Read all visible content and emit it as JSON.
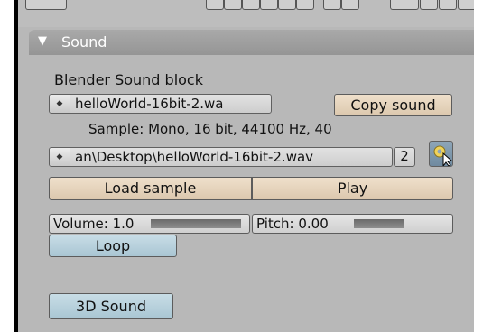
{
  "panel": {
    "title": "Sound",
    "collapse_icon": "triangle-down-icon"
  },
  "sound_block": {
    "label": "Blender Sound block",
    "name": "helloWorld-16bit-2.wa",
    "copy_button": "Copy sound"
  },
  "sample": {
    "info": "Sample: Mono, 16 bit, 44100 Hz, 40",
    "path": "an\\Desktop\\helloWorld-16bit-2.wav",
    "users": "2",
    "pack_icon": "gear-icon",
    "load_button": "Load sample",
    "play_button": "Play"
  },
  "controls": {
    "volume_label": "Volume: 1.0",
    "volume_fraction": 1.0,
    "pitch_label": "Pitch: 0.00",
    "loop_button": "Loop",
    "sound3d_button": "3D Sound"
  },
  "colors": {
    "panel_bg": "#b8b8b8",
    "button": "#e6d5bd",
    "toggle": "#b7d0dc"
  }
}
